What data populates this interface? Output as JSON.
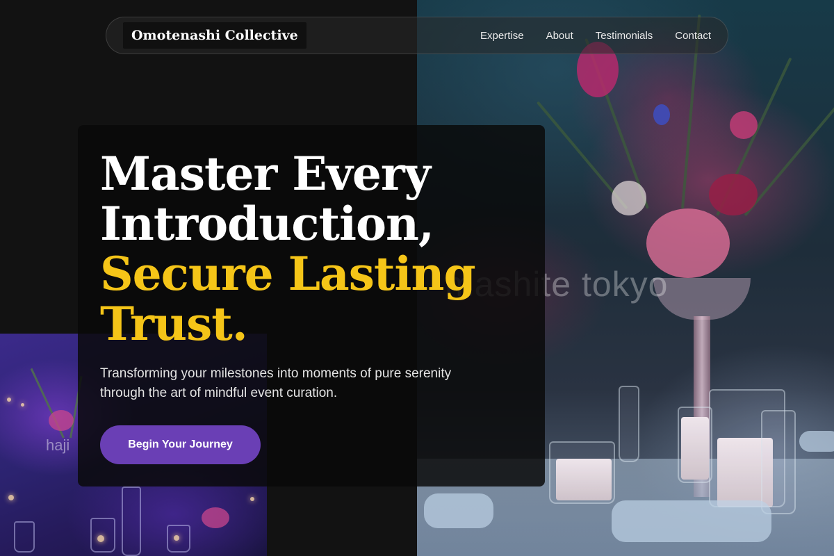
{
  "nav": {
    "brand": "Omotenashi Collective",
    "links": [
      "Expertise",
      "About",
      "Testimonials",
      "Contact"
    ]
  },
  "hero": {
    "headline_white_1": "Master Every",
    "headline_white_2": "Introduction,",
    "headline_accent_1": "Secure Lasting",
    "headline_accent_2": "Trust.",
    "subtitle_line_1": "Transforming your milestones into moments of pure serenity",
    "subtitle_line_2": "through the art of mindful event curation.",
    "cta_label": "Begin Your Journey"
  },
  "images": {
    "main_watermark": "mashite tokyo",
    "inset_watermark": "haji"
  },
  "colors": {
    "background": "#121212",
    "accent_yellow": "#f5c518",
    "cta_purple": "#6a3fb5"
  }
}
